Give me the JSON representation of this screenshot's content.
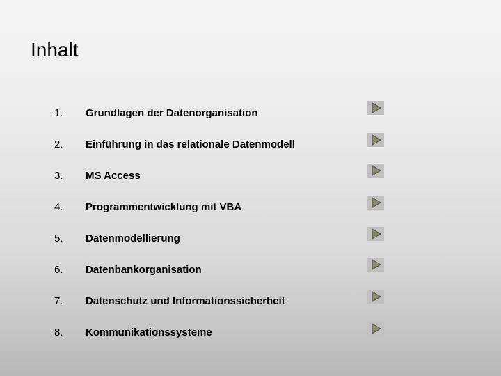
{
  "title": "Inhalt",
  "toc": {
    "items": [
      {
        "num": "1.",
        "label": "Grundlagen der Datenorganisation"
      },
      {
        "num": "2.",
        "label": "Einführung in das relationale Datenmodell"
      },
      {
        "num": "3.",
        "label": "MS Access"
      },
      {
        "num": "4.",
        "label": "Programmentwicklung mit VBA"
      },
      {
        "num": "5.",
        "label": "Datenmodellierung"
      },
      {
        "num": "6.",
        "label": "Datenbankorganisation"
      },
      {
        "num": "7.",
        "label": "Datenschutz und Informationssicherheit"
      },
      {
        "num": "8.",
        "label": "Kommunikationssysteme"
      }
    ]
  },
  "colors": {
    "arrow_fill": "#8a8a6f",
    "arrow_border": "#5a5a48",
    "arrow_bg": "#c0c0c0"
  }
}
